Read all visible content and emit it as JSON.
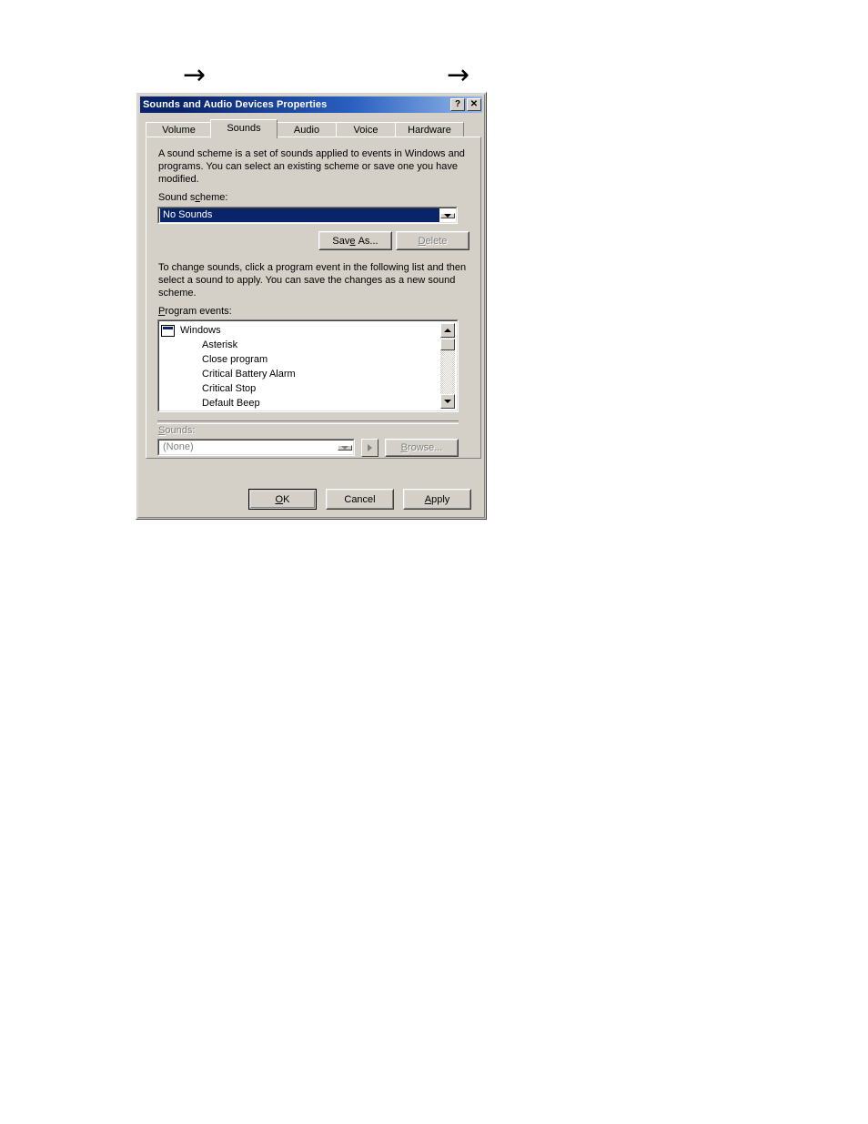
{
  "annotations": {
    "arrow_glyph": "→",
    "arrows": [
      "→",
      "→"
    ]
  },
  "window": {
    "title": "Sounds and Audio Devices Properties",
    "help_button": "?",
    "close_button": "✕",
    "titlebar_color_start": "#0a246a",
    "titlebar_color_end": "#93b8e8",
    "face_color": "#d4d0c8"
  },
  "tabs": [
    {
      "label": "Volume",
      "active": false
    },
    {
      "label": "Sounds",
      "active": true
    },
    {
      "label": "Audio",
      "active": false
    },
    {
      "label": "Voice",
      "active": false
    },
    {
      "label": "Hardware",
      "active": false
    }
  ],
  "panel": {
    "intro_text": "A sound scheme is a set of sounds applied to events in Windows and programs. You can select an existing scheme or save one you have modified.",
    "sound_scheme_label": "Sound scheme:",
    "sound_scheme_value": "No Sounds",
    "sound_scheme_options": [
      "No Sounds"
    ],
    "save_as_label": "Save As...",
    "delete_label": "Delete",
    "instruction_text": "To change sounds, click a program event in the following list and then select a sound to apply. You can save the changes as a new sound scheme.",
    "program_events_label": "Program events:",
    "program_events": [
      {
        "label": "Windows",
        "level": 0,
        "icon": "window-icon"
      },
      {
        "label": "Asterisk",
        "level": 1
      },
      {
        "label": "Close program",
        "level": 1
      },
      {
        "label": "Critical Battery Alarm",
        "level": 1
      },
      {
        "label": "Critical Stop",
        "level": 1
      },
      {
        "label": "Default Beep",
        "level": 1
      }
    ],
    "sounds_label": "Sounds:",
    "sounds_value": "(None)",
    "sounds_options": [
      "(None)"
    ],
    "browse_label": "Browse...",
    "play_icon": "play-icon"
  },
  "footer": {
    "ok_label": "OK",
    "cancel_label": "Cancel",
    "apply_label": "Apply"
  }
}
